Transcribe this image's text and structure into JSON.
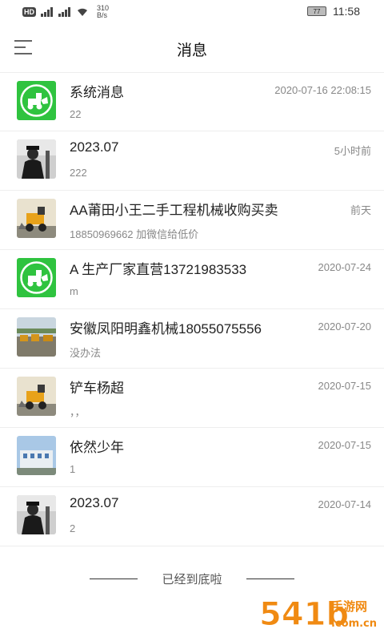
{
  "status_bar": {
    "hd": "HD",
    "net_speed_value": "310",
    "net_speed_unit": "B/s",
    "battery": "77",
    "time": "11:58"
  },
  "header": {
    "title": "消息"
  },
  "messages": [
    {
      "title": "系统消息",
      "subtitle": "22",
      "time": "2020-07-16 22:08:15",
      "avatar": "system-loader-icon"
    },
    {
      "title": "2023.07",
      "subtitle": "222",
      "time": "5小时前",
      "avatar": "person-photo"
    },
    {
      "title": "AA莆田小王二手工程机械收购买卖",
      "subtitle": "18850969662 加微信给低价",
      "time": "前天",
      "avatar": "loader-photo"
    },
    {
      "title": "A 生产厂家直营13721983533",
      "subtitle": "m",
      "time": "2020-07-24",
      "avatar": "system-loader-icon"
    },
    {
      "title": "安徽凤阳明鑫机械18055075556",
      "subtitle": "没办法",
      "time": "2020-07-20",
      "avatar": "machinery-yard-photo"
    },
    {
      "title": "铲车杨超",
      "subtitle": "，，",
      "time": "2020-07-15",
      "avatar": "loader-photo"
    },
    {
      "title": "依然少年",
      "subtitle": "1",
      "time": "2020-07-15",
      "avatar": "building-photo"
    },
    {
      "title": "2023.07",
      "subtitle": "2",
      "time": "2020-07-14",
      "avatar": "person-photo"
    }
  ],
  "footer": {
    "end_text": "已经到底啦"
  },
  "watermark": {
    "text": "541b手游网",
    "sub": "com.cn"
  },
  "colors": {
    "system_green": "#2fc33f",
    "watermark_orange": "#f08a12"
  }
}
